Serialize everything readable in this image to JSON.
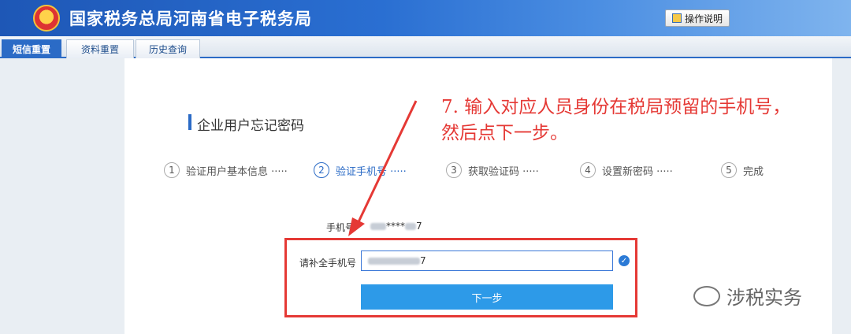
{
  "header": {
    "site_title": "国家税务总局河南省电子税务局",
    "help_label": "操作说明"
  },
  "tabs": [
    {
      "label": "短信重置",
      "active": true
    },
    {
      "label": "资料重置",
      "active": false
    },
    {
      "label": "历史查询",
      "active": false
    }
  ],
  "section": {
    "title": "企业用户忘记密码"
  },
  "steps": [
    {
      "num": "1",
      "label": "验证用户基本信息 ·····",
      "active": false
    },
    {
      "num": "2",
      "label": "验证手机号 ·····",
      "active": true
    },
    {
      "num": "3",
      "label": "获取验证码 ·····",
      "active": false
    },
    {
      "num": "4",
      "label": "设置新密码 ·····",
      "active": false
    },
    {
      "num": "5",
      "label": "完成",
      "active": false
    }
  ],
  "form": {
    "phone_label": "手机号",
    "phone_masked_middle": "****",
    "phone_masked_end": "7",
    "complete_phone_label": "请补全手机号",
    "complete_phone_value_end": "7",
    "next_button": "下一步"
  },
  "annotation": {
    "line1": "7. 输入对应人员身份在税局预留的手机号，",
    "line2": "然后点下一步。"
  },
  "watermark": {
    "text": "涉税实务"
  },
  "colors": {
    "header_blue": "#1e57b6",
    "tab_active": "#2b6bc6",
    "button_blue": "#2d9ae8",
    "annotation_red": "#e53935"
  }
}
